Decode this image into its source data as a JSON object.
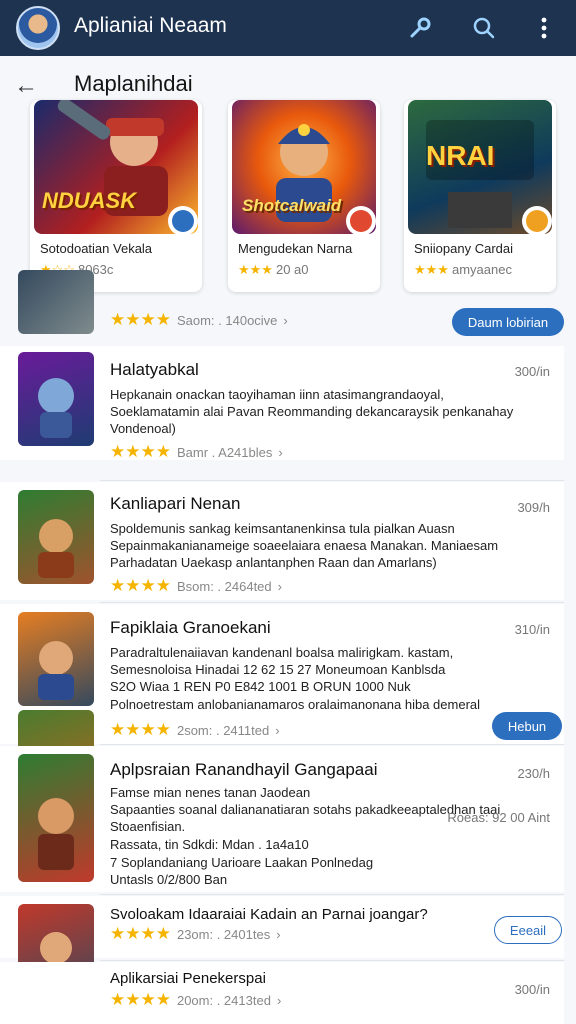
{
  "header": {
    "title": "Aplianiai Neaam",
    "icons": [
      "avatar",
      "key-icon",
      "search-icon",
      "more-vert-icon"
    ]
  },
  "section": {
    "title": "Maplanihdai",
    "back_icon": "back-arrow-icon"
  },
  "featured": [
    {
      "art_text": "NDUASK",
      "name": "Sotodoatian Vekala",
      "count": "8063c",
      "accent": "#2c6fbf"
    },
    {
      "art_text": "Shotcalwaid",
      "name": "Mengudekan Narna",
      "count": "20 a0",
      "accent": "#e04830"
    },
    {
      "art_text": "NRAI",
      "name": "Sniiopany Cardai",
      "count": "amyaanec",
      "accent": "#f0a020"
    }
  ],
  "top_row": {
    "meta": "Saom: . 140ocive",
    "button": "Daum lobirian"
  },
  "apps": [
    {
      "title": "Halatyabkal",
      "size": "300/in",
      "lines": [
        "Hepkanain onackan taoyihaman iinn atasimangrandaoyal,",
        "Soeklamatamin alai Pavan Reommanding dekancaraysik penkanahay"
      ],
      "tag": "Vondenoal)",
      "meta": "Bamr . A241bles"
    },
    {
      "title": "Kanliapari Nenan",
      "size": "309/h",
      "lines": [
        "Spoldemunis sankag keimsantanenkinsa tula pialkan Auasn",
        "Sepainmakanianameige soaeelaiara enaesa Manakan. Maniaesam",
        "Parhadatan Uaekasp anlantanphen Raan dan Amarlans)"
      ],
      "meta": "Bsom: . 2464ted"
    },
    {
      "title": "Fapiklaia Granoekani",
      "size": "310/in",
      "lines": [
        "Paradraltulenaiiavan kandenanl boalsa malirigkam. kastam,",
        "Semesnoloisa Hinadai 12 62 15 27 Moneumoan Kanblsda",
        "S2O Wiaa 1 REN P0 E842 1001 B ORUN 1000 Nuk",
        "Polnoetrestam anlobanianamaros oralaimanonana hiba demeral"
      ],
      "meta": "2som: . 2411ted",
      "button": "Hebun"
    },
    {
      "title": "Aplpsraian Ranandhayil Gangapaai",
      "size": "230/h",
      "lines": [
        "Famse mian nenes tanan Jaodean",
        "Sapaanties soanal daliananatiaran sotahs pakadkeeaptaledhan taai",
        "Stoaenfisian."
      ],
      "right_note": "Roeas: 92 00 Aint",
      "extra": "Rassata, tin Sdkdi: Mdan . 1a4a10",
      "blue_lines": [
        "7 Soplandaniang Uarioare Laakan Ponlnedag",
        "Untasls 0/2/800 Ban"
      ]
    },
    {
      "title": "Svoloakam Idaaraiai Kadain an Parnai joangar?",
      "meta": "23om: . 2401tes",
      "button": "Eeeail"
    },
    {
      "title": "Aplikarsiai Penekerspai",
      "size": "300/in",
      "meta": "20om: . 2413ted"
    }
  ]
}
